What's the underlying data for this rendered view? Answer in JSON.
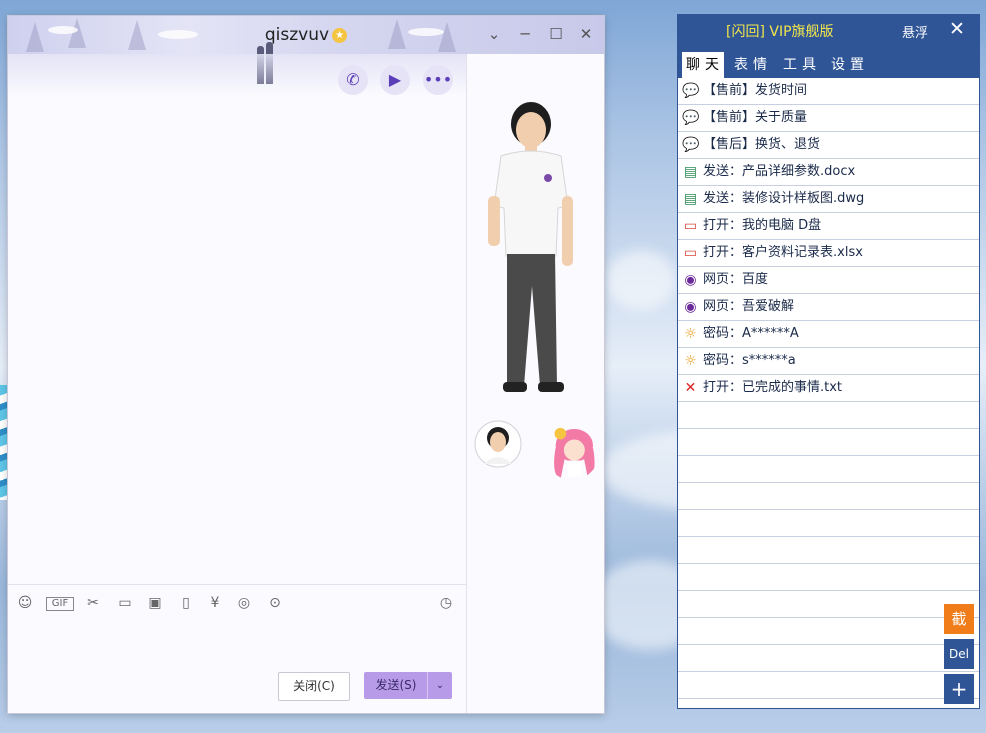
{
  "chat": {
    "title": "qiszvuv",
    "title_badge_icon": "vip-badge-icon",
    "window_controls": [
      "chevron-down-icon",
      "minimize-icon",
      "maximize-icon",
      "close-icon"
    ],
    "header_buttons": [
      "phone-icon",
      "video-call-icon",
      "more-icon"
    ],
    "toolbar_icons": [
      "emoji-icon",
      "gif-icon",
      "scissors-icon",
      "folder-icon",
      "image-icon",
      "shake-icon",
      "red-packet-icon",
      "music-icon",
      "more-tools-icon",
      "history-icon"
    ],
    "gif_label": "GIF",
    "close_button": "关闭(C)",
    "send_button": "发送(S)"
  },
  "vip": {
    "title": "[闪回] VIP旗舰版",
    "float_label": "悬浮",
    "close_label": "✕",
    "tabs": [
      "聊天",
      "表情",
      "工具",
      "设置"
    ],
    "active_tab": "聊天",
    "items": [
      {
        "icon": "chat-bubble-icon",
        "text": "【售前】发货时间"
      },
      {
        "icon": "chat-bubble-icon",
        "text": "【售前】关于质量"
      },
      {
        "icon": "chat-bubble-icon",
        "text": "【售后】换货、退货"
      },
      {
        "icon": "document-icon",
        "text": "发送：产品详细参数.docx"
      },
      {
        "icon": "document-icon",
        "text": "发送：装修设计样板图.dwg"
      },
      {
        "icon": "folder-icon",
        "text": "打开：我的电脑 D盘"
      },
      {
        "icon": "folder-icon",
        "text": "打开：客户资料记录表.xlsx"
      },
      {
        "icon": "web-icon",
        "text": "网页：百度"
      },
      {
        "icon": "web-icon",
        "text": "网页：吾爱破解"
      },
      {
        "icon": "sun-key-icon",
        "text": "密码：A******A"
      },
      {
        "icon": "sun-key-icon",
        "text": "密码：s******a"
      },
      {
        "icon": "x-mark-icon",
        "text": "打开：已完成的事情.txt"
      }
    ],
    "side_buttons": [
      {
        "label": "截",
        "color": "#f07c1a"
      },
      {
        "label": "Del",
        "color": "#2f5597"
      },
      {
        "label": "+",
        "color": "#2f5597"
      }
    ]
  }
}
